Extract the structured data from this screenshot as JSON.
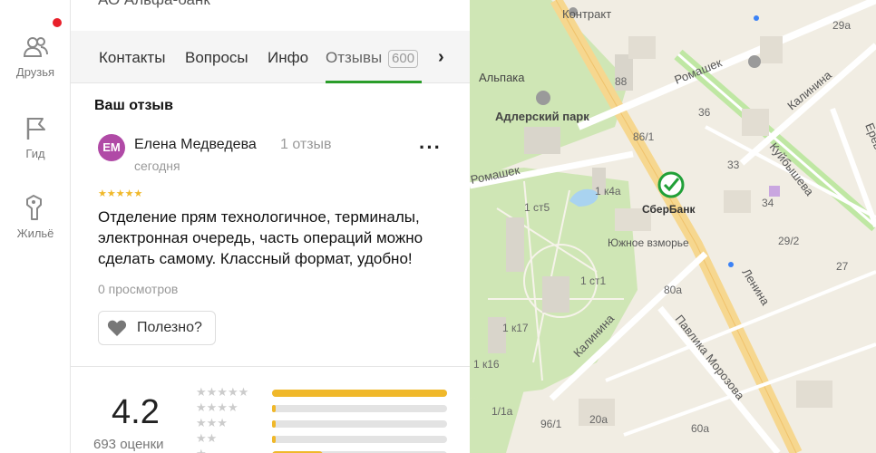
{
  "sidebar": {
    "items": [
      {
        "label": "Друзья",
        "icon": "friends-icon"
      },
      {
        "label": "Гид",
        "icon": "flag-icon"
      },
      {
        "label": "Жильё",
        "icon": "housing-icon"
      }
    ],
    "notification_color": "#e8202a"
  },
  "panel": {
    "bank_name": "АО Альфа-банк",
    "tabs": [
      {
        "label": "Контакты"
      },
      {
        "label": "Вопросы"
      },
      {
        "label": "Инфо"
      },
      {
        "label": "Отзывы",
        "count": "600",
        "active": true
      }
    ],
    "next_icon": "chevron-right-icon",
    "accent_color": "#2a9d2a"
  },
  "review": {
    "section_title": "Ваш отзыв",
    "avatar_initials": "ЕМ",
    "avatar_color": "#b04aa6",
    "author": "Елена Медведева",
    "author_reviews": "1 отзыв",
    "date": "сегодня",
    "more_label": "···",
    "stars": 5,
    "text": "Отделение прям технологичное, терминалы, электронная очередь, часть операций можно сделать самому. Классный формат, удобно!",
    "views": "0 просмотров",
    "useful_label": "Полезно?"
  },
  "summary": {
    "rating": "4.2",
    "rating_count": "693 оценки",
    "star_color": "#f0b82a",
    "distribution": [
      {
        "stars": 5,
        "fraction": 1.0
      },
      {
        "stars": 4,
        "fraction": 0.02
      },
      {
        "stars": 3,
        "fraction": 0.02
      },
      {
        "stars": 2,
        "fraction": 0.02
      },
      {
        "stars": 1,
        "fraction": 0.29
      }
    ]
  },
  "map": {
    "labels": {
      "kontrakt": "Контракт",
      "adler_park": "Адлерский парк",
      "alpaka": "Альпака",
      "romashek_top": "Ромашек",
      "romashek_left": "Ромашек",
      "kalinina_top": "Калинина",
      "kalinina_bottom": "Калинина",
      "erevanskaya": "Ереванская",
      "kuybysheva": "Куйбышева",
      "lenina": "Ленина",
      "pavlika": "Павлика Морозова",
      "sberbank": "СберБанк",
      "yuzhnoe": "Южное взморье",
      "n_29a": "29а",
      "n_88": "88",
      "n_36": "36",
      "n_861": "86/1",
      "n_33": "33",
      "n_34": "34",
      "n_292": "29/2",
      "n_27": "27",
      "n_1k4a": "1 к4а",
      "n_1st5": "1 ст5",
      "n_1st1": "1 ст1",
      "n_80a": "80а",
      "n_1k17": "1 к17",
      "n_1k16": "1 к16",
      "n_11a": "1/1а",
      "n_961": "96/1",
      "n_20a": "20а",
      "n_60a": "60а"
    }
  }
}
